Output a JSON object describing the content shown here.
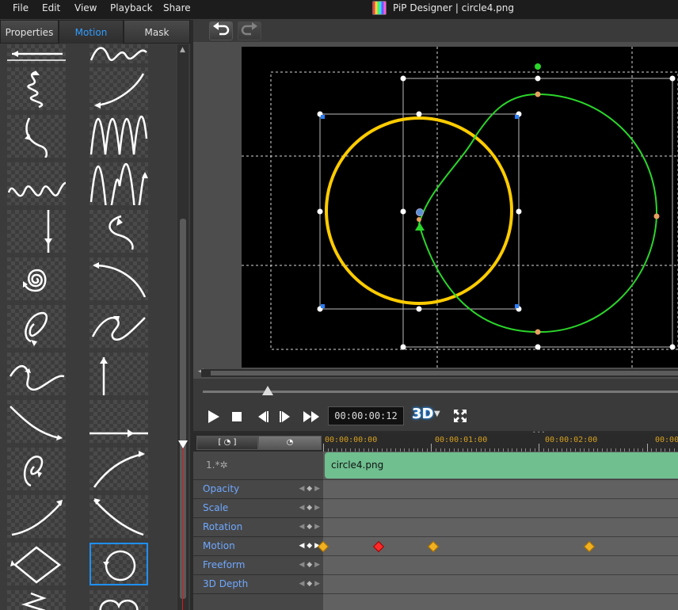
{
  "menu": {
    "file": "File",
    "edit": "Edit",
    "view": "View",
    "playback": "Playback",
    "share": "Share"
  },
  "app": {
    "title": "PiP Designer  |  circle4.png"
  },
  "panel": {
    "tabs": [
      "Properties",
      "Motion",
      "Mask"
    ],
    "active_tab": "Motion"
  },
  "motion_presets": {
    "count_visible": 26,
    "selected": "circle-path",
    "items": [
      "left-arrow-line",
      "wave-line",
      "squiggle-down",
      "curve-up-right",
      "hook-left",
      "large-wave",
      "small-wave",
      "tall-wave",
      "vertical-down",
      "s-curve-down",
      "spiral",
      "arc-right",
      "oval-loop",
      "zigzag-curve",
      "s-loop",
      "vertical-up",
      "diagonal-down",
      "horizontal-right",
      "loop-up",
      "arc-up-right",
      "diagonal-up-right",
      "arc-down-right",
      "diamond",
      "circle-path",
      "zigzag",
      "heart"
    ]
  },
  "toolbar": {
    "undo_icon": "undo-icon",
    "redo_icon": "redo-icon"
  },
  "transport": {
    "timecode": "00:00:00:12",
    "mode_3d": "3D"
  },
  "timeline": {
    "toggle_left": "[ ◔ ]",
    "toggle_right": "◔",
    "ruler": [
      "00:00:00:00",
      "00:00:01:00",
      "00:00:02:00"
    ],
    "object_label": "1.*✲",
    "clip_name": "circle4.png",
    "tracks": [
      "Opacity",
      "Scale",
      "Rotation",
      "Motion",
      "Freeform",
      "3D Depth"
    ],
    "motion_keyframe_times": [
      "00:00:00:00",
      "00:00:00:12",
      "00:00:01:00",
      "00:00:02:10"
    ],
    "current_time": "00:00:00:12"
  },
  "colors": {
    "accent": "#2f9cff",
    "circle": "#ffcc00",
    "path": "#2bd62b",
    "playhead": "#e01818",
    "clip": "#6fbf8f",
    "keyframe": "#f0b020"
  }
}
